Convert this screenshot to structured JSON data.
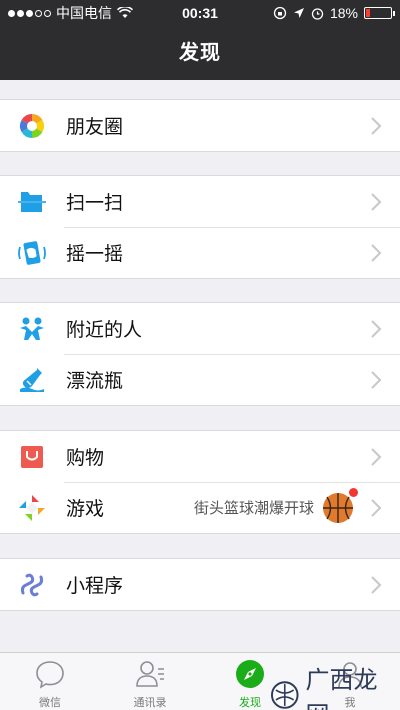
{
  "status_bar": {
    "carrier": "中国电信",
    "time": "00:31",
    "battery": "18%",
    "battery_level": 0.18,
    "signal_dots": 5,
    "signal_filled": 3
  },
  "nav": {
    "title": "发现"
  },
  "sections": [
    {
      "items": [
        {
          "label": "朋友圈",
          "icon": "moments-icon"
        }
      ]
    },
    {
      "items": [
        {
          "label": "扫一扫",
          "icon": "scan-icon"
        },
        {
          "label": "摇一摇",
          "icon": "shake-icon"
        }
      ]
    },
    {
      "items": [
        {
          "label": "附近的人",
          "icon": "people-nearby-icon"
        },
        {
          "label": "漂流瓶",
          "icon": "drift-bottle-icon"
        }
      ]
    },
    {
      "items": [
        {
          "label": "购物",
          "icon": "shopping-icon"
        },
        {
          "label": "游戏",
          "icon": "games-icon",
          "extra_text": "街头篮球潮爆开球",
          "extra_icon": "basketball-icon",
          "badge": true
        }
      ]
    },
    {
      "items": [
        {
          "label": "小程序",
          "icon": "mini-programs-icon"
        }
      ]
    }
  ],
  "tabbar": {
    "tabs": [
      {
        "label": "微信",
        "icon": "chat-bubble-icon",
        "active": false
      },
      {
        "label": "通讯录",
        "icon": "contacts-icon",
        "active": false
      },
      {
        "label": "发现",
        "icon": "discover-compass-icon",
        "active": true
      },
      {
        "label": "我",
        "icon": "me-icon",
        "active": false
      }
    ]
  },
  "watermark": {
    "text": "广西龙网"
  },
  "colors": {
    "header_bg": "#2d2d30",
    "page_bg": "#efeff4",
    "accent_green": "#1aad19",
    "badge_red": "#f43530",
    "battery_red": "#ff3b30"
  }
}
